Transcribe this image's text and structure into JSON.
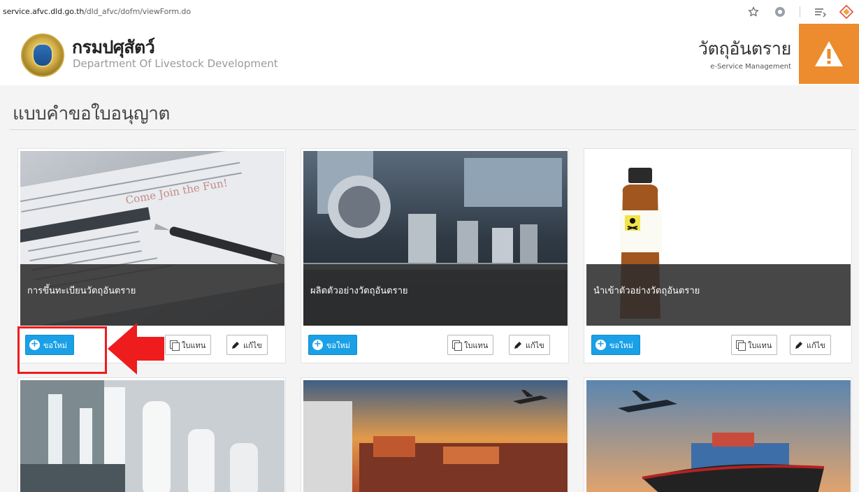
{
  "browser": {
    "url_prefix": "service.afvc.dld.go.th",
    "url_path": "/dld_afvc/dofm/viewForm.do",
    "icons": [
      "star-icon",
      "extension-icon",
      "reading-list-icon",
      "extension-diamond-icon"
    ]
  },
  "header": {
    "department_th": "กรมปศุสัตว์",
    "department_en": "Department Of Livestock Development",
    "system_th": "วัตถุอันตราย",
    "system_en": "e-Service Management",
    "warning_color": "#ec8c2e"
  },
  "page": {
    "title": "แบบคำขอใบอนุญาต"
  },
  "cards": [
    {
      "caption": "การขึ้นทะเบียนวัตถุอันตราย",
      "new_label": "ขอใหม่",
      "renew_label": "ใบแทน",
      "edit_label": "แก้ไข",
      "image": "registration-form-photo"
    },
    {
      "caption": "ผลิตตัวอย่างวัตถุอันตราย",
      "new_label": "ขอใหม่",
      "renew_label": "ใบแทน",
      "edit_label": "แก้ไข",
      "image": "factory-machine-photo"
    },
    {
      "caption": "นำเข้าตัวอย่างวัตถุอันตราย",
      "new_label": "ขอใหม่",
      "renew_label": "ใบแทน",
      "edit_label": "แก้ไข",
      "image": "poison-bottle-photo"
    },
    {
      "image": "bottle-production-line-photo"
    },
    {
      "image": "port-airplane-sunset-photo"
    },
    {
      "image": "cargo-ship-airplane-photo"
    }
  ],
  "colors": {
    "primary_button": "#1aa0e6",
    "highlight": "#ee1c1c"
  }
}
